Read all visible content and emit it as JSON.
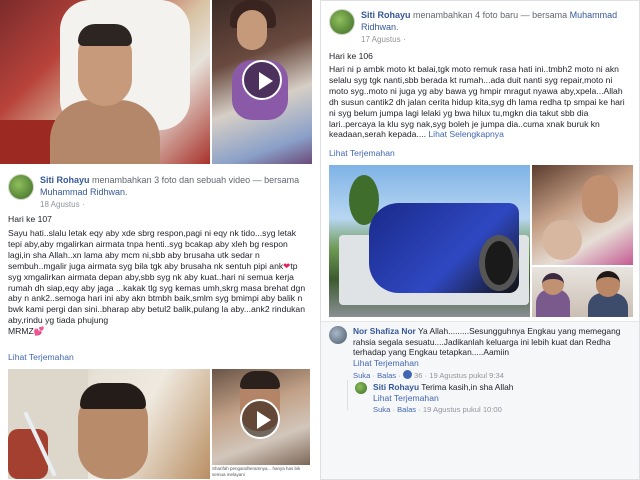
{
  "left_post_top": {
    "play_icon": "play-icon"
  },
  "left_post": {
    "author": "Siti Rohayu",
    "action": "menambahkan 3 foto dan sebuah video",
    "with_prefix": "— bersama",
    "tagged": "Muhammad Ridhwan",
    "period": ".",
    "time": "18 Agustus",
    "globe": "·",
    "day": "Hari ke 107",
    "body": "Sayu hati..slalu letak eqy aby xde sbrg respon,pagi ni eqy nk tido...syg letak tepi aby,aby mgalirkan airmata tnpa henti..syg bcakap aby xleh bg respon lagi,in sha Allah..xn lama aby mcm ni,sbb aby brusaha utk sedar n sembuh..mgalir juga airmata syg bila tgk aby brusaha nk sentuh pipi ank",
    "body2": "tp syg xmgalirkan airmata depan aby,sbb syg nk aby kuat..hari ni semua kerja rumah dh siap,eqy aby jaga ...kakak tlg syg kemas umh,skrg masa brehat dgn aby n ank2..semoga hari ini aby akn btmbh baik,smlm syg bmimpi aby balik n bwk kami pergi dan sini..bharap aby betul2 balik,pulang la aby...ank2 rindukan aby,rindu yg tiada phujung",
    "sign": "MRMZ",
    "see_translation": "Lihat Terjemahan",
    "photo_caption": "Sharifah pengandheramnya... hanya has bik semua melayani"
  },
  "right_post": {
    "author": "Siti Rohayu",
    "action": "menambahkan 4 foto baru",
    "with_prefix": "— bersama",
    "tagged": "Muhammad Ridhwan",
    "period": ".",
    "time": "17 Agustus",
    "globe": "·",
    "day": "Hari ke 106",
    "body": "Hari ni p ambk moto kt balai,tgk moto remuk rasa hati ini..tmbh2 moto ni akn selalu syg tgk nanti,sbb berada kt rumah...ada duit nanti syg repair,moto ni moto syg..moto ni juga yg aby bawa yg hmpir mragut nyawa aby,xpela...Allah dh susun cantik2 dh jalan cerita hidup kita,syg dh lama redha tp smpai ke hari ni syg belum jumpa lagi lelaki yg bwa hilux tu,mgkn dia takut sbb dia lari..percaya la klu syg nak,syg boleh je jumpa dia..cuma xnak buruk kn keadaan,serah kepada....",
    "see_more": "Lihat Selengkapnya",
    "see_translation": "Lihat Terjemahan"
  },
  "comments": [
    {
      "name": "Nor Shafiza Nor",
      "text": "Ya Allah.........Sesungguhnya Engkau yang memegang rahsia segala sesuatu....Jadikanlah keluarga ini lebih kuat dan Redha terhadap yang Engkau tetapkan.....Aamiin",
      "translate": "Lihat Terjemahan",
      "like": "Suka",
      "reply": "Balas",
      "likes": "36",
      "time": "19 Agustus pukul 9:34",
      "sep": "·"
    },
    {
      "name": "Siti Rohayu",
      "text": "Terima kasih,in sha Allah",
      "translate": "Lihat Terjemahan",
      "like": "Suka",
      "reply": "Balas",
      "time": "19 Agustus pukul 10:00",
      "sep": "·"
    }
  ]
}
